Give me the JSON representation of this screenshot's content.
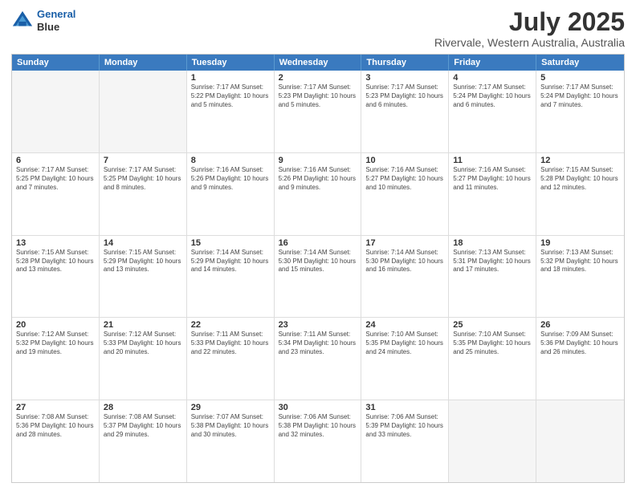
{
  "header": {
    "logo_line1": "General",
    "logo_line2": "Blue",
    "main_title": "July 2025",
    "subtitle": "Rivervale, Western Australia, Australia"
  },
  "calendar": {
    "days_of_week": [
      "Sunday",
      "Monday",
      "Tuesday",
      "Wednesday",
      "Thursday",
      "Friday",
      "Saturday"
    ],
    "weeks": [
      [
        {
          "day": "",
          "info": "",
          "empty": true
        },
        {
          "day": "",
          "info": "",
          "empty": true
        },
        {
          "day": "1",
          "info": "Sunrise: 7:17 AM\nSunset: 5:22 PM\nDaylight: 10 hours\nand 5 minutes."
        },
        {
          "day": "2",
          "info": "Sunrise: 7:17 AM\nSunset: 5:23 PM\nDaylight: 10 hours\nand 5 minutes."
        },
        {
          "day": "3",
          "info": "Sunrise: 7:17 AM\nSunset: 5:23 PM\nDaylight: 10 hours\nand 6 minutes."
        },
        {
          "day": "4",
          "info": "Sunrise: 7:17 AM\nSunset: 5:24 PM\nDaylight: 10 hours\nand 6 minutes."
        },
        {
          "day": "5",
          "info": "Sunrise: 7:17 AM\nSunset: 5:24 PM\nDaylight: 10 hours\nand 7 minutes."
        }
      ],
      [
        {
          "day": "6",
          "info": "Sunrise: 7:17 AM\nSunset: 5:25 PM\nDaylight: 10 hours\nand 7 minutes."
        },
        {
          "day": "7",
          "info": "Sunrise: 7:17 AM\nSunset: 5:25 PM\nDaylight: 10 hours\nand 8 minutes."
        },
        {
          "day": "8",
          "info": "Sunrise: 7:16 AM\nSunset: 5:26 PM\nDaylight: 10 hours\nand 9 minutes."
        },
        {
          "day": "9",
          "info": "Sunrise: 7:16 AM\nSunset: 5:26 PM\nDaylight: 10 hours\nand 9 minutes."
        },
        {
          "day": "10",
          "info": "Sunrise: 7:16 AM\nSunset: 5:27 PM\nDaylight: 10 hours\nand 10 minutes."
        },
        {
          "day": "11",
          "info": "Sunrise: 7:16 AM\nSunset: 5:27 PM\nDaylight: 10 hours\nand 11 minutes."
        },
        {
          "day": "12",
          "info": "Sunrise: 7:15 AM\nSunset: 5:28 PM\nDaylight: 10 hours\nand 12 minutes."
        }
      ],
      [
        {
          "day": "13",
          "info": "Sunrise: 7:15 AM\nSunset: 5:28 PM\nDaylight: 10 hours\nand 13 minutes."
        },
        {
          "day": "14",
          "info": "Sunrise: 7:15 AM\nSunset: 5:29 PM\nDaylight: 10 hours\nand 13 minutes."
        },
        {
          "day": "15",
          "info": "Sunrise: 7:14 AM\nSunset: 5:29 PM\nDaylight: 10 hours\nand 14 minutes."
        },
        {
          "day": "16",
          "info": "Sunrise: 7:14 AM\nSunset: 5:30 PM\nDaylight: 10 hours\nand 15 minutes."
        },
        {
          "day": "17",
          "info": "Sunrise: 7:14 AM\nSunset: 5:30 PM\nDaylight: 10 hours\nand 16 minutes."
        },
        {
          "day": "18",
          "info": "Sunrise: 7:13 AM\nSunset: 5:31 PM\nDaylight: 10 hours\nand 17 minutes."
        },
        {
          "day": "19",
          "info": "Sunrise: 7:13 AM\nSunset: 5:32 PM\nDaylight: 10 hours\nand 18 minutes."
        }
      ],
      [
        {
          "day": "20",
          "info": "Sunrise: 7:12 AM\nSunset: 5:32 PM\nDaylight: 10 hours\nand 19 minutes."
        },
        {
          "day": "21",
          "info": "Sunrise: 7:12 AM\nSunset: 5:33 PM\nDaylight: 10 hours\nand 20 minutes."
        },
        {
          "day": "22",
          "info": "Sunrise: 7:11 AM\nSunset: 5:33 PM\nDaylight: 10 hours\nand 22 minutes."
        },
        {
          "day": "23",
          "info": "Sunrise: 7:11 AM\nSunset: 5:34 PM\nDaylight: 10 hours\nand 23 minutes."
        },
        {
          "day": "24",
          "info": "Sunrise: 7:10 AM\nSunset: 5:35 PM\nDaylight: 10 hours\nand 24 minutes."
        },
        {
          "day": "25",
          "info": "Sunrise: 7:10 AM\nSunset: 5:35 PM\nDaylight: 10 hours\nand 25 minutes."
        },
        {
          "day": "26",
          "info": "Sunrise: 7:09 AM\nSunset: 5:36 PM\nDaylight: 10 hours\nand 26 minutes."
        }
      ],
      [
        {
          "day": "27",
          "info": "Sunrise: 7:08 AM\nSunset: 5:36 PM\nDaylight: 10 hours\nand 28 minutes."
        },
        {
          "day": "28",
          "info": "Sunrise: 7:08 AM\nSunset: 5:37 PM\nDaylight: 10 hours\nand 29 minutes."
        },
        {
          "day": "29",
          "info": "Sunrise: 7:07 AM\nSunset: 5:38 PM\nDaylight: 10 hours\nand 30 minutes."
        },
        {
          "day": "30",
          "info": "Sunrise: 7:06 AM\nSunset: 5:38 PM\nDaylight: 10 hours\nand 32 minutes."
        },
        {
          "day": "31",
          "info": "Sunrise: 7:06 AM\nSunset: 5:39 PM\nDaylight: 10 hours\nand 33 minutes."
        },
        {
          "day": "",
          "info": "",
          "empty": true
        },
        {
          "day": "",
          "info": "",
          "empty": true
        }
      ]
    ]
  }
}
